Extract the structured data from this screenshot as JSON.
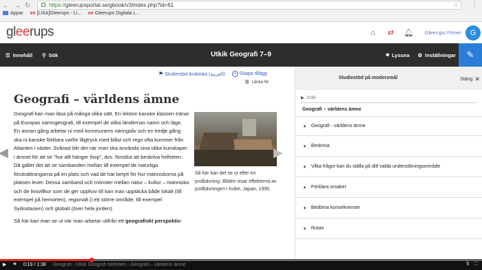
{
  "browser": {
    "url_scheme": "https://",
    "url_rest": "gleerupsportal.se/gbook/v3/index.php?id=61",
    "bookmarks": [
      {
        "label": "Appar"
      },
      {
        "label": "[LiSA]Gleerups - Li..."
      },
      {
        "label": "Gleerups Digitala L..."
      }
    ]
  },
  "site": {
    "logo_pre": "gl",
    "logo_ee": "ee",
    "logo_post": "rups",
    "user_name": "Gleerups Filmer",
    "avatar_letter": "G"
  },
  "toolbar": {
    "contents_label": "Innehåll",
    "search_label": "Sök",
    "title": "Utkik Geografi 7–9",
    "listen_label": "Lyssna",
    "settings_label": "Inställningar"
  },
  "content": {
    "studiestod_label": "Studiestöd Arabiska (العربية)",
    "create_addon_label": "Skapa tillägg",
    "link_label": "Länka hit",
    "title": "Geografi – världens ämne",
    "paragraph1": "Geografi kan man läsa på många olika sätt. En lektion kanske klassen tränar på Europas namngeografi, till exempel de olika ländernas namn och läge. En annan gång arbetar ni med kommunens näringsliv och en tredje gång ska ni kanske förklara varför lågtryck med blåst och regn ofta kommer från Atlanten i väster. Svårast blir det när man ska använda sina olika kunskaper i ämnet för att se ”hur allt hänger ihop”, dvs. försöka att beskriva helheten. Då gäller det att se sambanden mellan till exempel de naturliga förutsättningarna på en plats och vad de har betytt för hur människorna på platsen lever. Dessa samband och mönster mellan natur – kultur – människa och de livsvillkor som de ger upphov till kan man upptäcka både lokalt (till exempel på hemorten), regionalt (i ett större område, till exempel Sydostasien) och globalt (över hela jorden).",
    "paragraph2_pre": "Så här kan man se ut när man arbetar utifrån ett ",
    "paragraph2_bold": "geografiskt perspektiv",
    "paragraph2_post": ":",
    "caption": "Så här kan det se ut efter en jordbävning. Bilden visar effekterna av jordbävningen i Kobe, Japan, 1995."
  },
  "panel": {
    "title": "Studiestöd på modersmål",
    "close_label": "Stäng",
    "player_time": "0:00",
    "section_title": "Geografi – världens ämne",
    "items": [
      {
        "label": "Geografi - världens ämne"
      },
      {
        "label": "Beskriva"
      },
      {
        "label": "Vilka frågor kan du ställa på ditt valda undersökningsområde"
      },
      {
        "label": "Förklara orsaker"
      },
      {
        "label": "Bedöma konsekvenser"
      },
      {
        "label": "Rutan"
      }
    ]
  },
  "video": {
    "time": "0:19 / 1:38",
    "title": "Geografi - Utkik Geografi helheten - Geografi – världens ämne",
    "progress": 0.19,
    "right_label": "5"
  },
  "colors": {
    "accent_blue": "#2b7ed8",
    "brand_red": "#e23b3b",
    "toolbar_dark": "#2d2d2d",
    "video_red": "#e52222"
  }
}
